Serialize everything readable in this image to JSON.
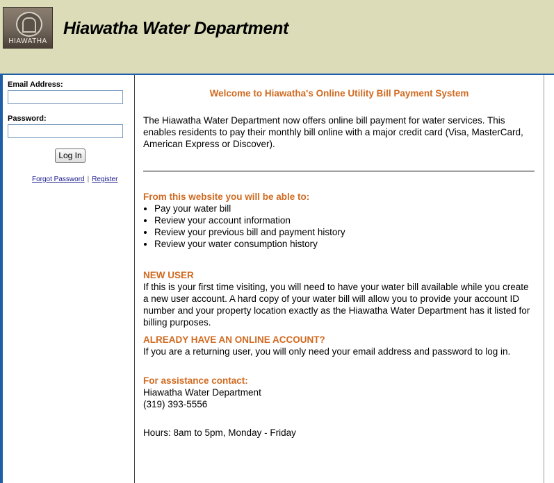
{
  "header": {
    "title": "Hiawatha Water Department",
    "logo_text": "HIAWATHA"
  },
  "sidebar": {
    "email_label": "Email Address:",
    "email_value": "",
    "password_label": "Password:",
    "password_value": "",
    "login_button": "Log In",
    "forgot_password": "Forgot Password",
    "separator": "|",
    "register": "Register"
  },
  "main": {
    "welcome": "Welcome to Hiawatha's Online Utility Bill Payment System",
    "intro": "The Hiawatha Water Department now offers online bill payment for water services. This enables residents to pay their monthly bill online with a major credit card (Visa, MasterCard, American Express or Discover).",
    "features_heading": "From this website you will be able to:",
    "features": [
      "Pay your water bill",
      "Review your account information",
      "Review your previous bill and payment history",
      "Review your water consumption history"
    ],
    "new_user_heading": "NEW USER",
    "new_user_text": "If this is your first time visiting, you will need to have your water bill available while you create a new user account. A hard copy of your water bill will allow you to provide your account ID number and your property location exactly as the Hiawatha Water Department has it listed for billing purposes.",
    "account_heading": "ALREADY HAVE AN ONLINE ACCOUNT?",
    "account_text": "If you are a returning user, you will only need your email address and password to log in.",
    "assist_heading": "For assistance contact:",
    "assist_name": "Hiawatha Water Department",
    "assist_phone": "(319) 393-5556",
    "hours": "Hours: 8am to 5pm, Monday - Friday"
  },
  "colors": {
    "header_bg": "#dcdcb8",
    "accent_orange": "#d06a20",
    "accent_blue": "#1f5fa8",
    "link": "#1a1a8c"
  }
}
